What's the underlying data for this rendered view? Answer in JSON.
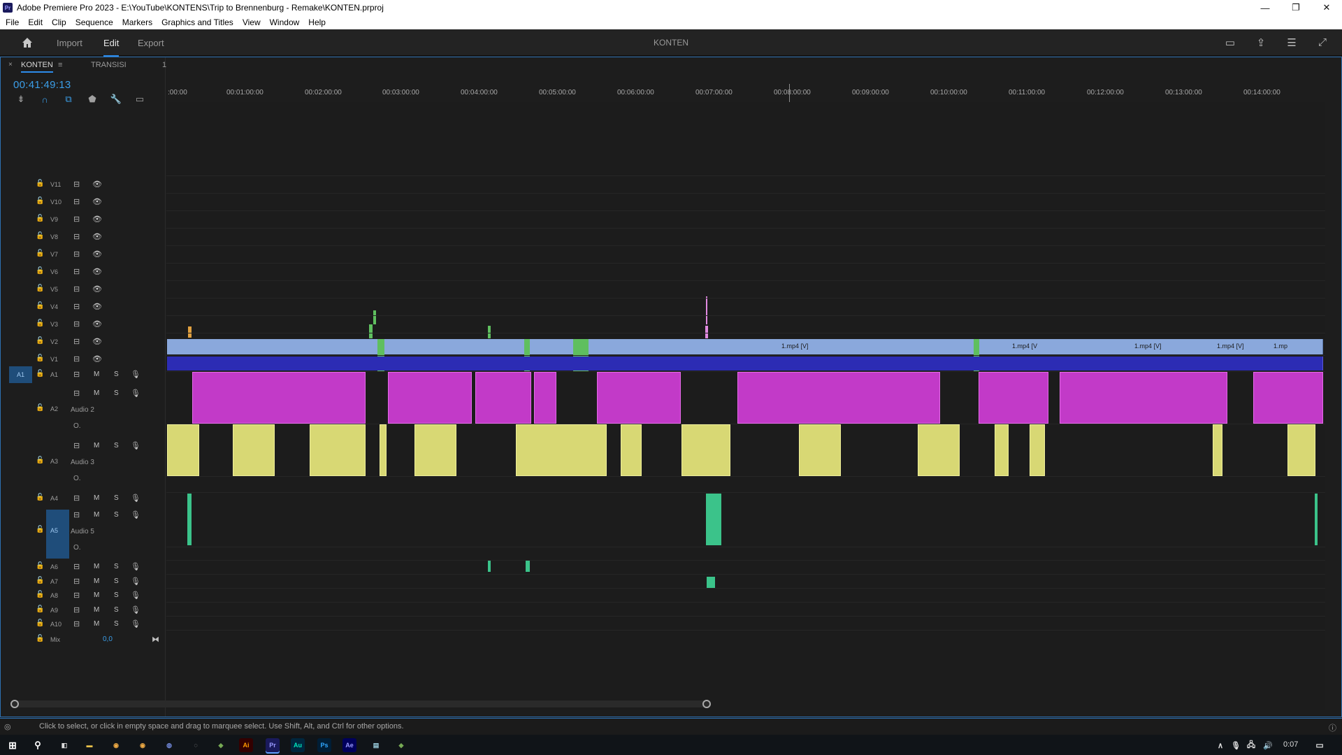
{
  "window": {
    "title": "Adobe Premiere Pro 2023 - E:\\YouTube\\KONTENS\\Trip to Brennenburg - Remake\\KONTEN.prproj",
    "app_icon": "Pr",
    "minimize": "—",
    "restore": "❐",
    "close": "✕"
  },
  "menu": [
    "File",
    "Edit",
    "Clip",
    "Sequence",
    "Markers",
    "Graphics and Titles",
    "View",
    "Window",
    "Help"
  ],
  "header": {
    "workspaces": [
      "Import",
      "Edit",
      "Export"
    ],
    "active_workspace": "Edit",
    "project_name": "KONTEN",
    "icons": [
      "panel-icon",
      "share-icon",
      "workspace-menu-icon",
      "fullscreen-icon"
    ]
  },
  "panel": {
    "close_glyph": "×",
    "tabs": [
      {
        "label": "KONTEN",
        "active": true
      },
      {
        "label": "TRANSISI",
        "active": false
      },
      {
        "label": "1",
        "active": false
      }
    ],
    "tab_menu_glyph": "≡",
    "timecode": "00:41:49:13",
    "tools": [
      "insert-edit-icon",
      "snap-icon",
      "linked-selection-icon",
      "add-marker-icon",
      "settings-wrench-icon",
      "captions-icon"
    ]
  },
  "ruler": {
    "ticks": [
      ":00:00",
      "00:01:00:00",
      "00:02:00:00",
      "00:03:00:00",
      "00:04:00:00",
      "00:05:00:00",
      "00:06:00:00",
      "00:07:00:00",
      "00:08:00:00",
      "00:09:00:00",
      "00:10:00:00",
      "00:11:00:00",
      "00:12:00:00",
      "00:13:00:00",
      "00:14:00:00"
    ]
  },
  "video_tracks": [
    "V11",
    "V10",
    "V9",
    "V8",
    "V7",
    "V6",
    "V5",
    "V4",
    "V3",
    "V2",
    "V1"
  ],
  "audio_tracks": [
    {
      "name": "A1",
      "source": "A1",
      "label": ""
    },
    {
      "name": "A2",
      "label": "Audio 2"
    },
    {
      "name": "A3",
      "label": "Audio 3"
    },
    {
      "name": "A4",
      "label": ""
    },
    {
      "name": "A5",
      "label": "Audio 5"
    },
    {
      "name": "A6",
      "label": ""
    },
    {
      "name": "A7",
      "label": ""
    },
    {
      "name": "A8",
      "label": ""
    },
    {
      "name": "A9",
      "label": ""
    },
    {
      "name": "A10",
      "label": ""
    }
  ],
  "track_buttons": {
    "mute": "M",
    "solo": "S",
    "keyframe": "O."
  },
  "mix": {
    "label": "Mix",
    "value": "0,0"
  },
  "clip_labels": [
    "1.mp4 [V]",
    "1.mp4 [V",
    "1.mp4 [V]",
    "1.mp4 [V]",
    "1.mp"
  ],
  "status": {
    "text": "Click to select, or click in empty space and drag to marquee select. Use Shift, Alt, and Ctrl for other options."
  },
  "taskbar": {
    "apps": [
      "Ai",
      "Pr",
      "Au",
      "Ps",
      "Ae"
    ],
    "clock": "0:07"
  },
  "colors": {
    "accent": "#2d8ceb",
    "timecode": "#3b9ee8",
    "video_clip": "#8aa8dc",
    "audio1_clip": "#2c2cb4",
    "audio2_clip": "#c23ac8",
    "audio3_clip": "#d8d874",
    "audio5_clip": "#3bc38a",
    "workarea": "#d6d04a"
  }
}
